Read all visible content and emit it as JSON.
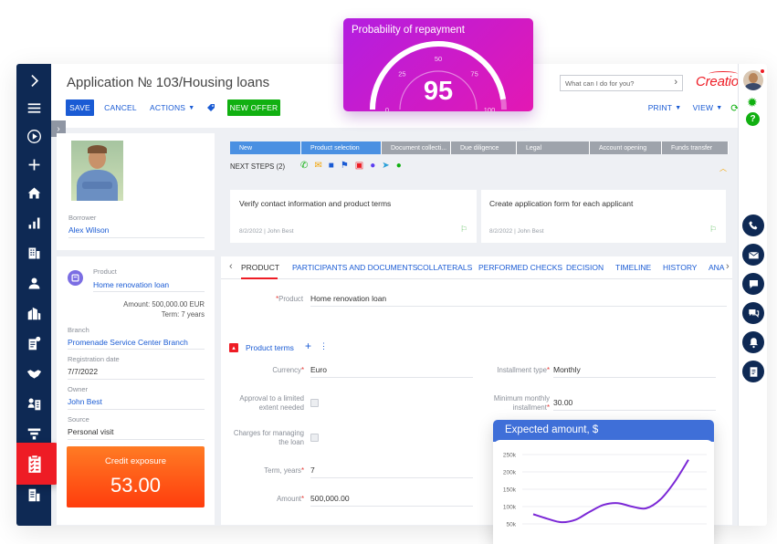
{
  "header": {
    "title": "Application № 103/Housing loans",
    "save_label": "SAVE",
    "cancel_label": "CANCEL",
    "actions_label": "ACTIONS",
    "new_offer_label": "NEW OFFER",
    "print_label": "PRINT",
    "view_label": "VIEW",
    "search_placeholder": "What can I do for you?",
    "logo_text": "Creatio"
  },
  "borrower": {
    "label": "Borrower",
    "name": "Alex Wilson"
  },
  "product_card": {
    "product_label": "Product",
    "product_value": "Home renovation loan",
    "amount_text": "Amount: 500,000.00 EUR",
    "term_text": "Term: 7 years",
    "branch_label": "Branch",
    "branch_value": "Promenade Service Center Branch",
    "registration_label": "Registration date",
    "registration_value": "7/7/2022",
    "owner_label": "Owner",
    "owner_value": "John Best",
    "source_label": "Source",
    "source_value": "Personal visit"
  },
  "credit_exposure": {
    "label": "Credit exposure",
    "value": "53.00",
    "gradient_from": "#ff7b24",
    "gradient_to": "#ff3d0d"
  },
  "stages": [
    "New",
    "Product selection",
    "Document collecti...",
    "Due diligence",
    "Legal",
    "Account opening",
    "Funds transfer"
  ],
  "next_steps_label": "NEXT STEPS (2)",
  "tasks": [
    {
      "title": "Verify contact information and product terms",
      "date": "8/2/2022",
      "owner": "John Best"
    },
    {
      "title": "Create application form for each applicant",
      "date": "8/2/2022",
      "owner": "John Best"
    }
  ],
  "tabs": [
    "PRODUCT",
    "PARTICIPANTS AND DOCUMENTS",
    "COLLATERALS",
    "PERFORMED CHECKS",
    "DECISION",
    "TIMELINE",
    "HISTORY",
    "ANA"
  ],
  "form": {
    "product_label": "Product",
    "product_value": "Home renovation loan",
    "section_title": "Product terms",
    "currency_label": "Currency",
    "currency_value": "Euro",
    "installment_type_label": "Installment type",
    "installment_type_value": "Monthly",
    "approval_label_1": "Approval to a limited",
    "approval_label_2": "extent needed",
    "min_installment_label_1": "Minimum monthly",
    "min_installment_label_2": "installment",
    "min_installment_value": "30.00",
    "charges_label_1": "Charges for managing",
    "charges_label_2": "the loan",
    "term_label": "Term, years",
    "term_value": "7",
    "amount_label": "Amount",
    "amount_value": "500,000.00"
  },
  "probability_widget": {
    "title": "Probability of repayment",
    "value": 95,
    "ticks": [
      "0",
      "25",
      "50",
      "75",
      "100"
    ],
    "color_from": "#b31ee0",
    "color_to": "#e318b3"
  },
  "chart_data": {
    "type": "line",
    "title": "Expected amount, $",
    "xlabel": "",
    "ylabel": "",
    "ylim": [
      50000,
      250000
    ],
    "yticks": [
      "250k",
      "200k",
      "150k",
      "100k",
      "50k"
    ],
    "x": [
      0,
      1,
      2,
      3,
      4,
      5,
      6,
      7,
      8,
      9,
      10,
      11
    ],
    "series": [
      {
        "values": [
          78000,
          65000,
          55000,
          62000,
          85000,
          105000,
          110000,
          100000,
          95000,
          120000,
          170000,
          235000
        ],
        "color": "#7b28d6"
      }
    ]
  },
  "colors": {
    "navy": "#0e2954",
    "accent_blue": "#1a5bd4",
    "green": "#11b011",
    "stage_active": "#4a90e2",
    "stage_inactive": "#9ea3ab"
  }
}
